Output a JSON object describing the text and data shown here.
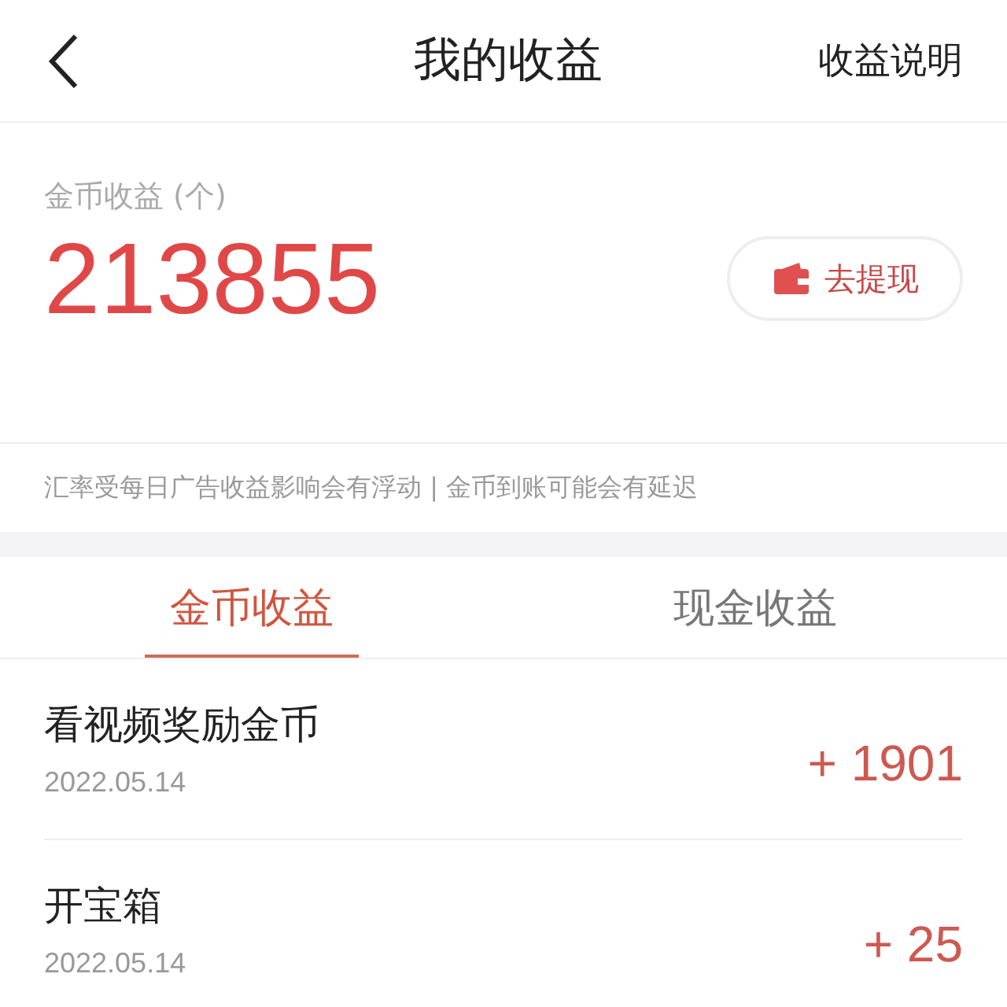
{
  "header": {
    "title": "我的收益",
    "help": "收益说明"
  },
  "balance": {
    "label": "金币收益 (个)",
    "amount": "213855",
    "withdraw": "去提现"
  },
  "notice": "汇率受每日广告收益影响会有浮动 | 金币到账可能会有延迟",
  "tabs": [
    {
      "label": "金币收益",
      "selected": true
    },
    {
      "label": "现金收益",
      "selected": false
    }
  ],
  "records": [
    {
      "title": "看视频奖励金币",
      "date": "2022.05.14",
      "amount": "+ 1901"
    },
    {
      "title": "开宝箱",
      "date": "2022.05.14",
      "amount": "+ 25"
    }
  ]
}
